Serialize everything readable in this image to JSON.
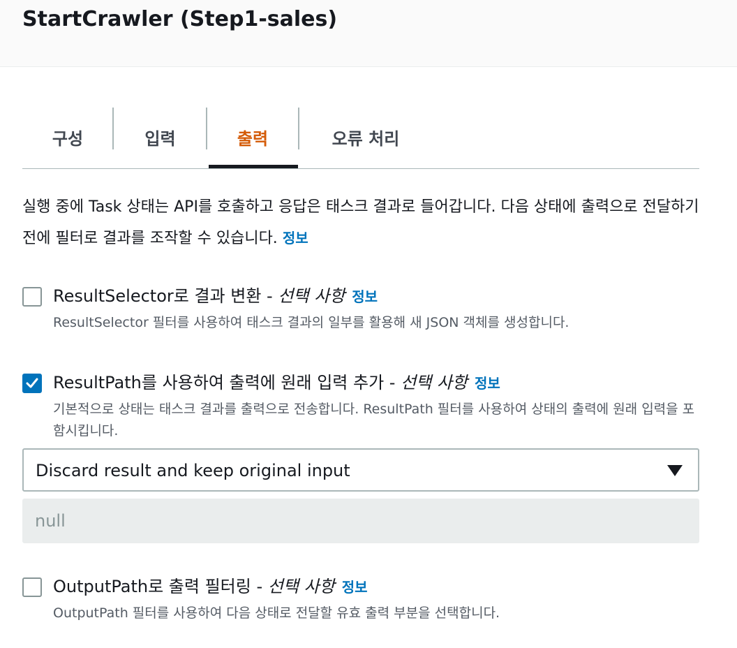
{
  "panel": {
    "title": "StartCrawler (Step1-sales)"
  },
  "tabs": [
    {
      "label": "구성",
      "active": false
    },
    {
      "label": "입력",
      "active": false
    },
    {
      "label": "출력",
      "active": true
    },
    {
      "label": "오류 처리",
      "active": false
    }
  ],
  "description": {
    "text": "실행 중에 Task 상태는 API를 호출하고 응답은 태스크 결과로 들어갑니다. 다음 상태에 출력으로 전달하기 전에 필터로 결과를 조작할 수 있습니다.",
    "info_link": "정보"
  },
  "options": {
    "result_selector": {
      "label": "ResultSelector로 결과 변환 - ",
      "optional": "선택 사항",
      "info_link": "정보",
      "help": "ResultSelector 필터를 사용하여 태스크 결과의 일부를 활용해 새 JSON 객체를 생성합니다.",
      "checked": false
    },
    "result_path": {
      "label": "ResultPath를 사용하여 출력에 원래 입력 추가 - ",
      "optional": "선택 사항",
      "info_link": "정보",
      "help": "기본적으로 상태는 태스크 결과를 출력으로 전송합니다. ResultPath 필터를 사용하여 상태의 출력에 원래 입력을 포함시킵니다.",
      "checked": true,
      "select_value": "Discard result and keep original input",
      "readonly_value": "null"
    },
    "output_path": {
      "label": "OutputPath로 출력 필터링 - ",
      "optional": "선택 사항",
      "info_link": "정보",
      "help": "OutputPath 필터를 사용하여 다음 상태로 전달할 유효 출력 부분을 선택합니다.",
      "checked": false
    }
  },
  "colors": {
    "active_tab": "#d45b07",
    "link": "#0073bb",
    "checkbox_checked": "#0073bb"
  },
  "icons": {
    "checkmark": "check-icon",
    "dropdown": "caret-down-icon"
  }
}
